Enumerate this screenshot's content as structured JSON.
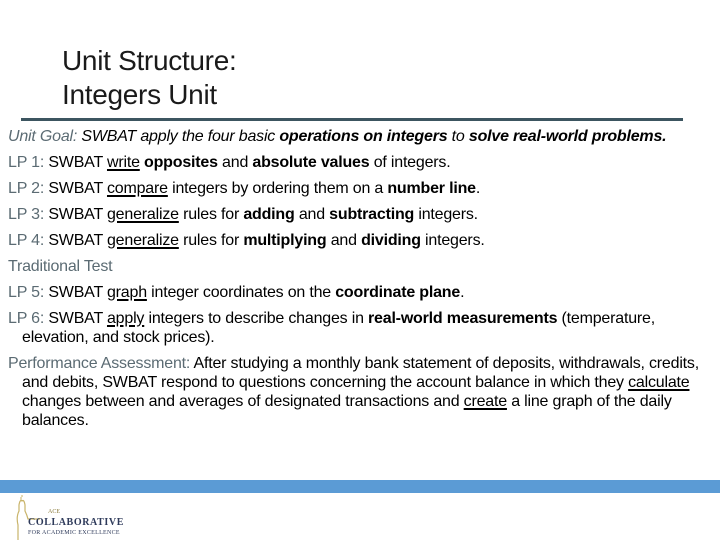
{
  "title": {
    "line1": "Unit Structure:",
    "line2": "Integers Unit"
  },
  "colors": {
    "label": "#5b6b73",
    "rule": "#3c5560",
    "footer_bar": "#5b9bd5"
  },
  "unit_goal": {
    "label": "Unit Goal:",
    "t1": " SWBAT apply the four basic ",
    "b1": "operations on integers",
    "t2": " to ",
    "b2": "solve real-world problems",
    "t3": "."
  },
  "lp1": {
    "label": "LP 1:",
    "t1": " SWBAT ",
    "u1": "write",
    "t2": " ",
    "b1": "opposites",
    "t3": " and ",
    "b2": "absolute values",
    "t4": " of integers."
  },
  "lp2": {
    "label": "LP 2:",
    "t1": " SWBAT ",
    "u1": "compare",
    "t2": " integers by ordering them on a ",
    "b1": "number line",
    "t3": "."
  },
  "lp3": {
    "label": "LP 3:",
    "t1": " SWBAT ",
    "u1": "generalize",
    "t2": " rules for ",
    "b1": "adding",
    "t3": " and ",
    "b2": "subtracting",
    "t4": " integers."
  },
  "lp4": {
    "label": "LP 4:",
    "t1": " SWBAT ",
    "u1": "generalize",
    "t2": " rules for ",
    "b1": "multiplying",
    "t3": " and ",
    "b2": "dividing",
    "t4": " integers."
  },
  "traditional_test": "Traditional Test",
  "lp5": {
    "label": "LP 5:",
    "t1": " SWBAT ",
    "u1": "graph",
    "t2": " integer coordinates on the ",
    "b1": "coordinate plane",
    "t3": "."
  },
  "lp6": {
    "label": "LP 6:",
    "t1": " SWBAT ",
    "u1": "apply",
    "t2": " integers to describe changes in ",
    "b1": "real-world measurements",
    "t3": " (temperature, elevation, and stock prices)."
  },
  "performance": {
    "label": "Performance Assessment:",
    "t1": "  After studying a monthly bank statement of deposits, withdrawals, credits, and debits, SWBAT respond to questions concerning the account balance in which they ",
    "u1": "calculate",
    "t2": " changes between and averages of designated transactions and ",
    "u2": "create",
    "t3": " a line graph of the daily balances."
  },
  "logo": {
    "ace": "ACE",
    "main": "COLLABORATIVE",
    "sub": "FOR ACADEMIC EXCELLENCE"
  }
}
